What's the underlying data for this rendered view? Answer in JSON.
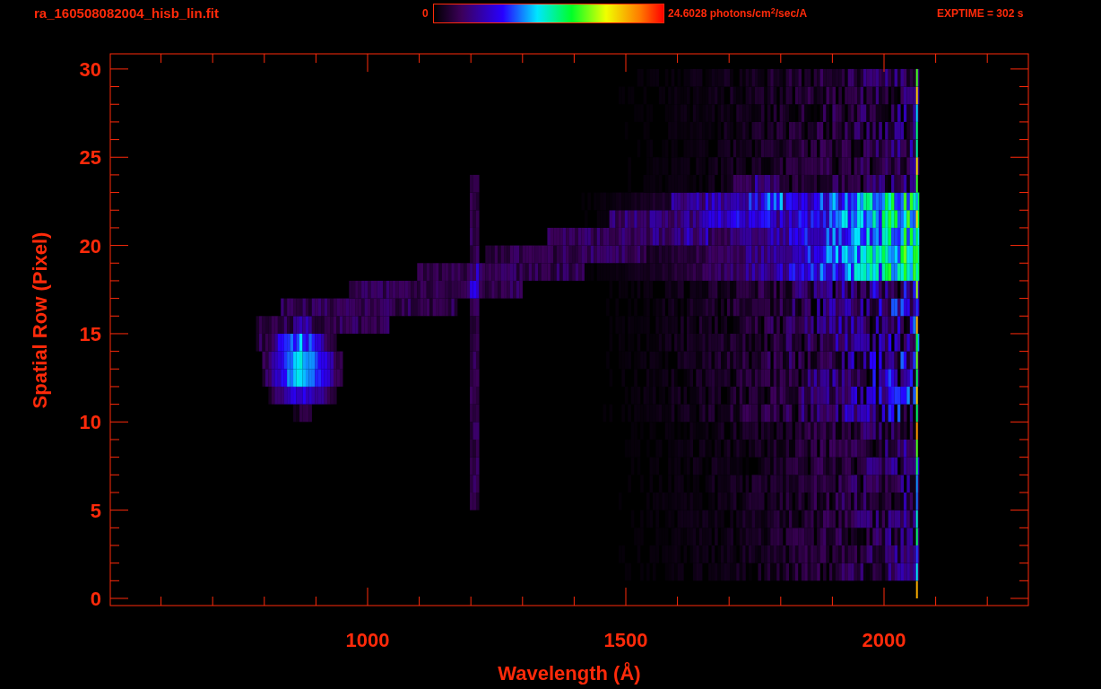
{
  "header": {
    "filename": "ra_160508082004_hisb_lin.fit",
    "colorbar": {
      "min_label": "0",
      "max_label": "24.6028 photons/cm$^{2}$/sec/A"
    },
    "exptime": "EXPTIME = 302 s"
  },
  "plot": {
    "ylabel": "Spatial Row (Pixel)",
    "xlabel": "Wavelength (Å)",
    "yticks": [
      "30",
      "25",
      "20",
      "15",
      "10",
      "5",
      "0"
    ],
    "xticks": [
      "1000",
      "1500",
      "2000"
    ]
  }
}
